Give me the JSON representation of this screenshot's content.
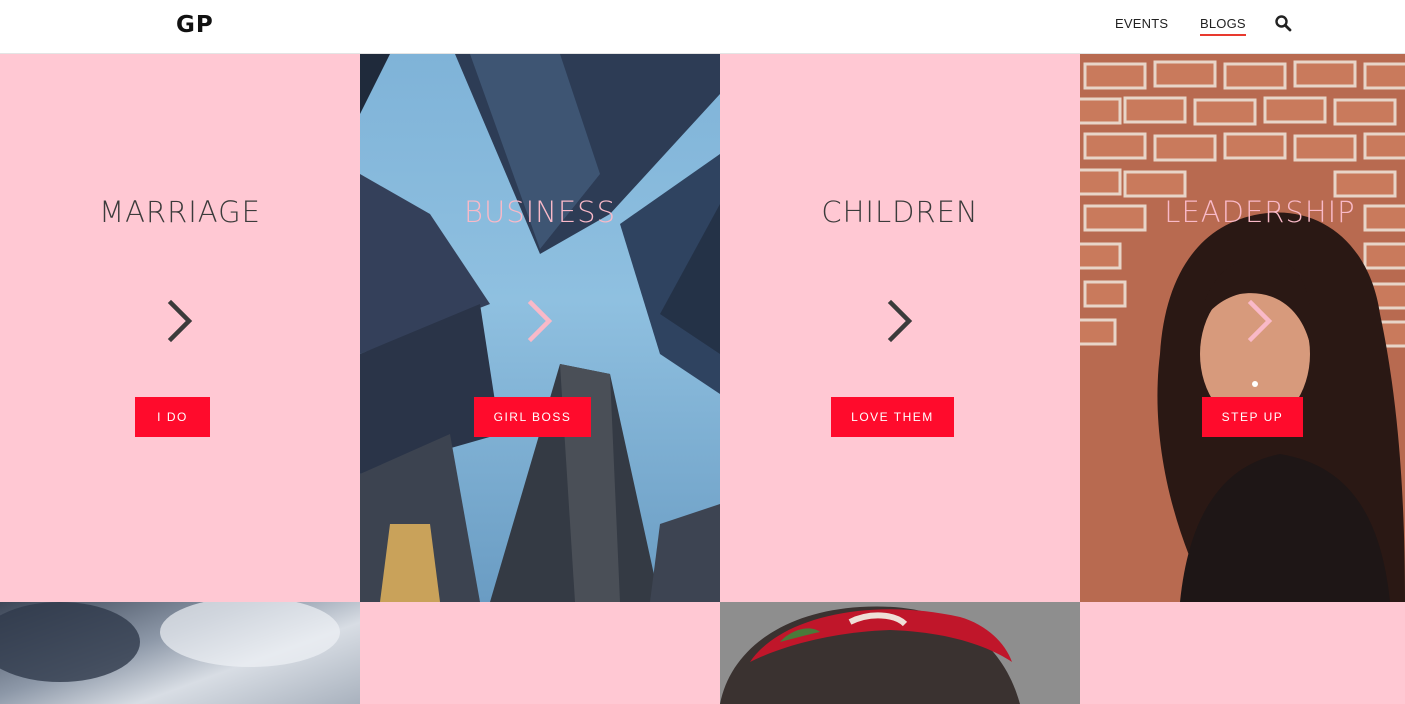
{
  "header": {
    "logo": "GP",
    "nav": [
      {
        "label": "EVENTS",
        "active": false
      },
      {
        "label": "BLOGS",
        "active": true
      }
    ],
    "search_icon": "search-icon",
    "active_underline_color": "#e8392e"
  },
  "tiles": [
    {
      "title": "MARRIAGE",
      "button": "I DO",
      "background": "pink",
      "icon": "chevron-right-icon"
    },
    {
      "title": "BUSINESS",
      "button": "GIRL BOSS",
      "background": "photo-skyscrapers",
      "icon": "chevron-right-icon"
    },
    {
      "title": "CHILDREN",
      "button": "LOVE THEM",
      "background": "pink",
      "icon": "chevron-right-icon"
    },
    {
      "title": "LEADERSHIP",
      "button": "STEP UP",
      "background": "photo-woman-brick-wall",
      "icon": "chevron-right-icon"
    }
  ],
  "bottom_row": [
    {
      "background": "photo-clouds"
    },
    {
      "background": "pink"
    },
    {
      "background": "photo-red-headband"
    },
    {
      "background": "pink"
    }
  ],
  "colors": {
    "pink": "#ffc8d3",
    "button_red": "#ff0b2c",
    "title_dark": "#3b3b3b",
    "title_light": "#f9b9c8"
  }
}
